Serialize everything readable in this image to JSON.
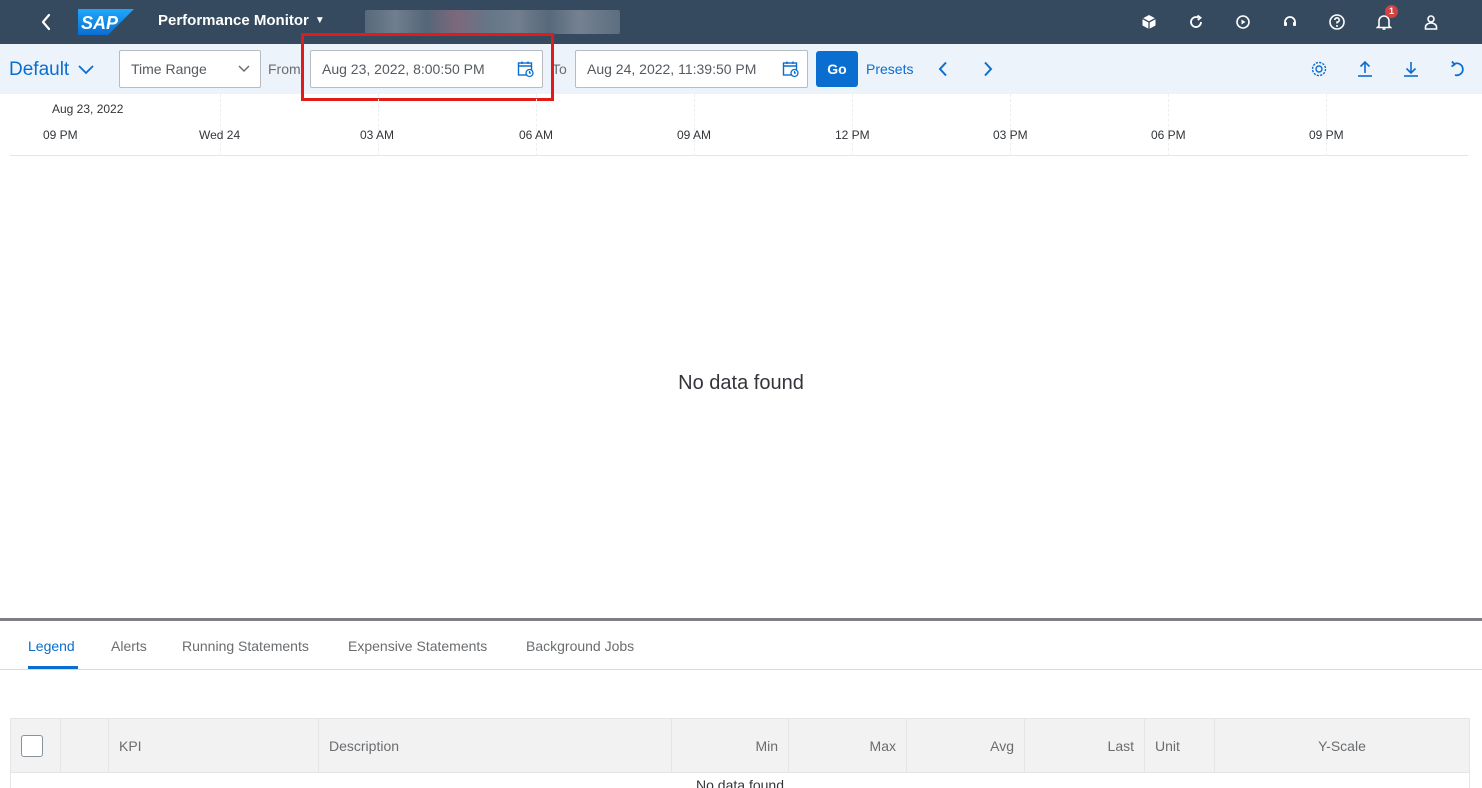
{
  "shell": {
    "logo_text": "SAP",
    "title": "Performance Monitor",
    "notification_count": "1",
    "icons": [
      "back-icon",
      "cube-icon",
      "refresh-icon",
      "play-icon",
      "support-icon",
      "help-icon",
      "bell-icon",
      "user-icon"
    ]
  },
  "filterbar": {
    "variant": "Default",
    "time_range": "Time Range",
    "from_label": "From",
    "from_value": "Aug 23, 2022, 8:00:50 PM",
    "to_label": "To",
    "to_value": "Aug 24, 2022, 11:39:50 PM",
    "go_label": "Go",
    "presets_label": "Presets"
  },
  "timeline": {
    "date_label": "Aug 23, 2022",
    "ticks": [
      "09 PM",
      "Wed 24",
      "03 AM",
      "06 AM",
      "09 AM",
      "12 PM",
      "03 PM",
      "06 PM",
      "09 PM"
    ]
  },
  "chart_area": {
    "empty_text": "No data found"
  },
  "tabs": [
    "Legend",
    "Alerts",
    "Running Statements",
    "Expensive Statements",
    "Background Jobs"
  ],
  "table": {
    "columns": [
      "KPI",
      "Description",
      "Min",
      "Max",
      "Avg",
      "Last",
      "Unit",
      "Y-Scale"
    ],
    "empty_text": "No data found"
  },
  "colors": {
    "shell": "#354a5f",
    "accent": "#0a6ed1",
    "highlight": "#e11a1a"
  }
}
